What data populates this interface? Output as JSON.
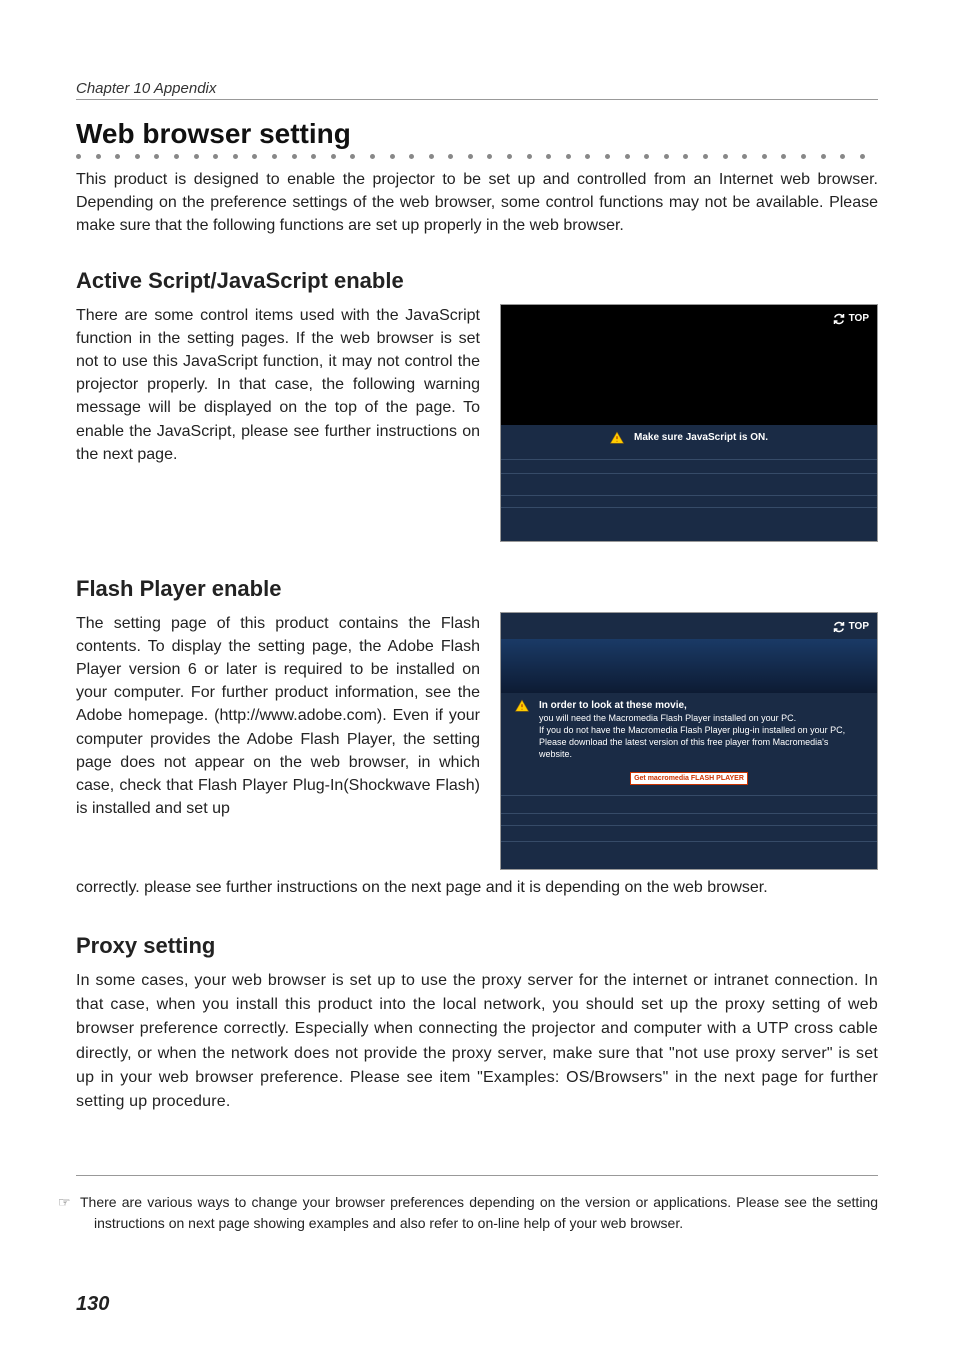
{
  "chapter": "Chapter 10 Appendix",
  "section_title": "Web browser setting",
  "intro": "This product is designed to enable the projector to be set up and controlled from an Internet web browser. Depending on the preference settings of the web browser, some control functions may not be available. Please make sure that the following functions are set up properly in the web browser.",
  "s1": {
    "title": "Active Script/JavaScript enable",
    "body": "There are some control items used with the JavaScript function in the setting pages. If the web browser is set not to use this JavaScript function, it may not control the projector properly. In that case, the following warning message will be displayed on the top of the page. To enable the JavaScript, please see further instructions on the next page.",
    "fig": {
      "top_label": "TOP",
      "warn": "Make sure JavaScript is ON."
    }
  },
  "s2": {
    "title": "Flash Player enable",
    "body": "The setting page of this product contains the Flash contents. To display the setting page, the Adobe Flash Player version 6 or later is required to be installed on your computer. For further product information, see the Adobe homepage. (http://www.adobe.com). Even if your computer provides the Adobe Flash Player, the setting page does not appear on the web browser, in which case, check that Flash Player Plug-In(Shockwave Flash) is installed and set up",
    "tail": "correctly. please see further instructions on the next page and it is depending on the web browser.",
    "fig": {
      "top_label": "TOP",
      "warn_title": "In order to look at these movie,",
      "warn_lines": "you will need the Macromedia Flash Player installed on your PC.\nIf you do not have the Macromedia Flash Player plug-in installed on your PC,\nPlease download the latest version of this free player from Macromedia's website.",
      "button": "Get macromedia\nFLASH\nPLAYER"
    }
  },
  "s3": {
    "title": "Proxy setting",
    "body": "In some cases, your web browser is set up to use the proxy server for the internet or intranet connection. In that case, when you install this product into the local network, you should set up the proxy setting of web browser preference correctly. Especially when connecting the projector and computer with a UTP cross cable directly, or when the network does not provide the proxy server, make sure that \"not use proxy server\" is set up in your web browser preference.  Please see item \"Examples: OS/Browsers\" in the next page for further setting up procedure."
  },
  "footnote": "There are various ways to change your browser preferences depending on the version or applications. Please see the setting instructions on next page showing examples and also refer to on-line help of your web browser.",
  "page_number": "130"
}
